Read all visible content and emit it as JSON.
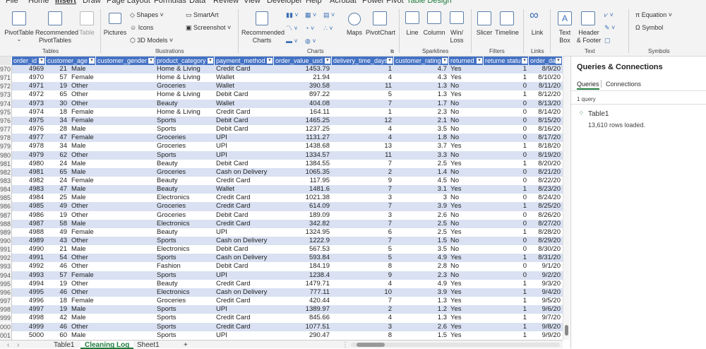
{
  "menu": {
    "items": [
      "File",
      "Home",
      "Insert",
      "Draw",
      "Page Layout",
      "Formulas",
      "Data",
      "Review",
      "View",
      "Developer",
      "Help",
      "Acrobat",
      "Power Pivot",
      "Table Design"
    ],
    "active": "Insert"
  },
  "ribbon": {
    "pivot_table": "PivotTable",
    "recommended_pivot_l1": "Recommended",
    "recommended_pivot_l2": "PivotTables",
    "table": "Table",
    "pictures": "Pictures",
    "shapes": "Shapes",
    "icons": "Icons",
    "models_3d": "3D Models",
    "smartart": "SmartArt",
    "screenshot": "Screenshot",
    "recommended_charts_l1": "Recommended",
    "recommended_charts_l2": "Charts",
    "maps": "Maps",
    "pivot_chart": "PivotChart",
    "line": "Line",
    "column": "Column",
    "winloss_l1": "Win/",
    "winloss_l2": "Loss",
    "slicer": "Slicer",
    "timeline": "Timeline",
    "link": "Link",
    "textbox_l1": "Text",
    "textbox_l2": "Box",
    "header_l1": "Header",
    "header_l2": "& Footer",
    "equation": "Equation",
    "symbol": "Symbol",
    "groups": {
      "tables": "Tables",
      "illustrations": "Illustrations",
      "charts": "Charts",
      "sparklines": "Sparklines",
      "filters": "Filters",
      "links": "Links",
      "text": "Text",
      "symbols": "Symbols"
    }
  },
  "table": {
    "headers": [
      "order_id",
      "customer_age",
      "customer_gender",
      "product_category",
      "payment_method",
      "order_value_usd",
      "delivery_time_days",
      "customer_rating",
      "returned",
      "returne statu",
      "order_date"
    ],
    "rows": [
      {
        "rn": "970",
        "id": "4969",
        "age": "21",
        "gender": "Male",
        "cat": "Home & Living",
        "pay": "Credit Card",
        "val": "1453.79",
        "days": "1",
        "rating": "4.7",
        "ret": "Yes",
        "rs": "1",
        "date": "8/9/20"
      },
      {
        "rn": "971",
        "id": "4970",
        "age": "57",
        "gender": "Female",
        "cat": "Home & Living",
        "pay": "Wallet",
        "val": "21.94",
        "days": "4",
        "rating": "4.3",
        "ret": "Yes",
        "rs": "1",
        "date": "8/10/20"
      },
      {
        "rn": "972",
        "id": "4971",
        "age": "19",
        "gender": "Other",
        "cat": "Groceries",
        "pay": "Wallet",
        "val": "390.58",
        "days": "11",
        "rating": "1.3",
        "ret": "No",
        "rs": "0",
        "date": "8/11/20"
      },
      {
        "rn": "973",
        "id": "4972",
        "age": "65",
        "gender": "Other",
        "cat": "Home & Living",
        "pay": "Debit Card",
        "val": "897.22",
        "days": "5",
        "rating": "1.3",
        "ret": "Yes",
        "rs": "1",
        "date": "8/12/20"
      },
      {
        "rn": "974",
        "id": "4973",
        "age": "30",
        "gender": "Other",
        "cat": "Beauty",
        "pay": "Wallet",
        "val": "404.08",
        "days": "7",
        "rating": "1.7",
        "ret": "No",
        "rs": "0",
        "date": "8/13/20"
      },
      {
        "rn": "975",
        "id": "4974",
        "age": "18",
        "gender": "Female",
        "cat": "Home & Living",
        "pay": "Credit Card",
        "val": "164.11",
        "days": "1",
        "rating": "2.3",
        "ret": "No",
        "rs": "0",
        "date": "8/14/20"
      },
      {
        "rn": "976",
        "id": "4975",
        "age": "34",
        "gender": "Female",
        "cat": "Sports",
        "pay": "Debit Card",
        "val": "1465.25",
        "days": "12",
        "rating": "2.1",
        "ret": "No",
        "rs": "0",
        "date": "8/15/20"
      },
      {
        "rn": "977",
        "id": "4976",
        "age": "28",
        "gender": "Male",
        "cat": "Sports",
        "pay": "Debit Card",
        "val": "1237.25",
        "days": "4",
        "rating": "3.5",
        "ret": "No",
        "rs": "0",
        "date": "8/16/20"
      },
      {
        "rn": "978",
        "id": "4977",
        "age": "47",
        "gender": "Female",
        "cat": "Groceries",
        "pay": "UPI",
        "val": "1131.27",
        "days": "4",
        "rating": "1.8",
        "ret": "No",
        "rs": "0",
        "date": "8/17/20"
      },
      {
        "rn": "979",
        "id": "4978",
        "age": "34",
        "gender": "Male",
        "cat": "Groceries",
        "pay": "UPI",
        "val": "1438.68",
        "days": "13",
        "rating": "3.7",
        "ret": "Yes",
        "rs": "1",
        "date": "8/18/20"
      },
      {
        "rn": "980",
        "id": "4979",
        "age": "62",
        "gender": "Other",
        "cat": "Sports",
        "pay": "UPI",
        "val": "1334.57",
        "days": "11",
        "rating": "3.3",
        "ret": "No",
        "rs": "0",
        "date": "8/19/20"
      },
      {
        "rn": "981",
        "id": "4980",
        "age": "24",
        "gender": "Male",
        "cat": "Beauty",
        "pay": "Debit Card",
        "val": "1384.55",
        "days": "7",
        "rating": "2.5",
        "ret": "Yes",
        "rs": "1",
        "date": "8/20/20"
      },
      {
        "rn": "982",
        "id": "4981",
        "age": "65",
        "gender": "Male",
        "cat": "Groceries",
        "pay": "Cash on Delivery",
        "val": "1065.35",
        "days": "2",
        "rating": "1.4",
        "ret": "No",
        "rs": "0",
        "date": "8/21/20"
      },
      {
        "rn": "983",
        "id": "4982",
        "age": "24",
        "gender": "Female",
        "cat": "Beauty",
        "pay": "Credit Card",
        "val": "117.95",
        "days": "9",
        "rating": "4.5",
        "ret": "No",
        "rs": "0",
        "date": "8/22/20"
      },
      {
        "rn": "984",
        "id": "4983",
        "age": "47",
        "gender": "Male",
        "cat": "Beauty",
        "pay": "Wallet",
        "val": "1481.6",
        "days": "7",
        "rating": "3.1",
        "ret": "Yes",
        "rs": "1",
        "date": "8/23/20"
      },
      {
        "rn": "985",
        "id": "4984",
        "age": "25",
        "gender": "Male",
        "cat": "Electronics",
        "pay": "Credit Card",
        "val": "1021.38",
        "days": "3",
        "rating": "3",
        "ret": "No",
        "rs": "0",
        "date": "8/24/20"
      },
      {
        "rn": "986",
        "id": "4985",
        "age": "49",
        "gender": "Other",
        "cat": "Groceries",
        "pay": "Credit Card",
        "val": "614.09",
        "days": "7",
        "rating": "3.9",
        "ret": "Yes",
        "rs": "1",
        "date": "8/25/20"
      },
      {
        "rn": "987",
        "id": "4986",
        "age": "19",
        "gender": "Other",
        "cat": "Groceries",
        "pay": "Debit Card",
        "val": "189.09",
        "days": "3",
        "rating": "2.6",
        "ret": "No",
        "rs": "0",
        "date": "8/26/20"
      },
      {
        "rn": "988",
        "id": "4987",
        "age": "58",
        "gender": "Male",
        "cat": "Electronics",
        "pay": "Credit Card",
        "val": "342.82",
        "days": "7",
        "rating": "2.5",
        "ret": "No",
        "rs": "0",
        "date": "8/27/20"
      },
      {
        "rn": "989",
        "id": "4988",
        "age": "49",
        "gender": "Female",
        "cat": "Beauty",
        "pay": "UPI",
        "val": "1324.95",
        "days": "6",
        "rating": "2.5",
        "ret": "Yes",
        "rs": "1",
        "date": "8/28/20"
      },
      {
        "rn": "990",
        "id": "4989",
        "age": "43",
        "gender": "Other",
        "cat": "Sports",
        "pay": "Cash on Delivery",
        "val": "1222.9",
        "days": "7",
        "rating": "1.5",
        "ret": "No",
        "rs": "0",
        "date": "8/29/20"
      },
      {
        "rn": "991",
        "id": "4990",
        "age": "21",
        "gender": "Male",
        "cat": "Electronics",
        "pay": "Debit Card",
        "val": "567.53",
        "days": "5",
        "rating": "3.5",
        "ret": "No",
        "rs": "0",
        "date": "8/30/20"
      },
      {
        "rn": "992",
        "id": "4991",
        "age": "54",
        "gender": "Other",
        "cat": "Sports",
        "pay": "Cash on Delivery",
        "val": "593.84",
        "days": "5",
        "rating": "4.9",
        "ret": "Yes",
        "rs": "1",
        "date": "8/31/20"
      },
      {
        "rn": "993",
        "id": "4992",
        "age": "46",
        "gender": "Other",
        "cat": "Fashion",
        "pay": "Debit Card",
        "val": "184.19",
        "days": "8",
        "rating": "2.8",
        "ret": "No",
        "rs": "0",
        "date": "9/1/20"
      },
      {
        "rn": "994",
        "id": "4993",
        "age": "57",
        "gender": "Female",
        "cat": "Sports",
        "pay": "UPI",
        "val": "1238.4",
        "days": "9",
        "rating": "2.3",
        "ret": "No",
        "rs": "0",
        "date": "9/2/20"
      },
      {
        "rn": "995",
        "id": "4994",
        "age": "19",
        "gender": "Other",
        "cat": "Beauty",
        "pay": "Credit Card",
        "val": "1479.71",
        "days": "4",
        "rating": "4.9",
        "ret": "Yes",
        "rs": "1",
        "date": "9/3/20"
      },
      {
        "rn": "996",
        "id": "4995",
        "age": "46",
        "gender": "Other",
        "cat": "Electronics",
        "pay": "Cash on Delivery",
        "val": "777.11",
        "days": "10",
        "rating": "3.9",
        "ret": "Yes",
        "rs": "1",
        "date": "9/4/20"
      },
      {
        "rn": "997",
        "id": "4996",
        "age": "18",
        "gender": "Female",
        "cat": "Groceries",
        "pay": "Credit Card",
        "val": "420.44",
        "days": "7",
        "rating": "1.3",
        "ret": "Yes",
        "rs": "1",
        "date": "9/5/20"
      },
      {
        "rn": "998",
        "id": "4997",
        "age": "19",
        "gender": "Male",
        "cat": "Sports",
        "pay": "UPI",
        "val": "1389.97",
        "days": "2",
        "rating": "1.2",
        "ret": "Yes",
        "rs": "1",
        "date": "9/6/20"
      },
      {
        "rn": "999",
        "id": "4998",
        "age": "42",
        "gender": "Male",
        "cat": "Sports",
        "pay": "Credit Card",
        "val": "845.66",
        "days": "4",
        "rating": "1.3",
        "ret": "Yes",
        "rs": "1",
        "date": "9/7/20"
      },
      {
        "rn": "000",
        "id": "4999",
        "age": "46",
        "gender": "Other",
        "cat": "Sports",
        "pay": "Credit Card",
        "val": "1077.51",
        "days": "3",
        "rating": "2.6",
        "ret": "Yes",
        "rs": "1",
        "date": "9/8/20"
      },
      {
        "rn": "001",
        "id": "5000",
        "age": "60",
        "gender": "Male",
        "cat": "Sports",
        "pay": "UPI",
        "val": "290.47",
        "days": "8",
        "rating": "1.5",
        "ret": "Yes",
        "rs": "1",
        "date": "9/9/20"
      }
    ]
  },
  "sheet_tabs": [
    "Table1",
    "Cleaning Log",
    "Sheet1"
  ],
  "active_tab": "Cleaning Log",
  "pane": {
    "title": "Queries & Connections",
    "tabs": [
      "Queries",
      "Connections"
    ],
    "count": "1 query",
    "query_name": "Table1",
    "query_status": "13,610 rows loaded."
  },
  "colors": {
    "header_bg": "#4472c4",
    "band_bg": "#d9e1f2",
    "accent": "#1e7b3c"
  }
}
